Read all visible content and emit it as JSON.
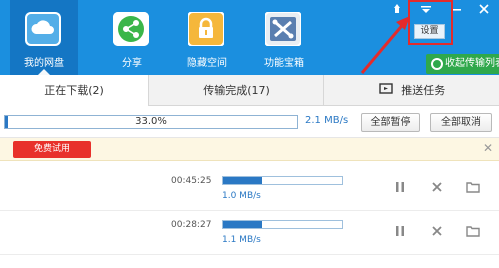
{
  "header": {
    "nav": [
      {
        "label": "我的网盘",
        "icon": "cloud-drive-icon",
        "active": true
      },
      {
        "label": "分享",
        "icon": "share-icon",
        "active": false
      },
      {
        "label": "隐藏空间",
        "icon": "lock-icon",
        "active": false
      },
      {
        "label": "功能宝箱",
        "icon": "toolbox-icon",
        "active": false
      }
    ],
    "settings_label": "设置",
    "collapse_label": "收起传输列表",
    "colors": {
      "header_bg": "#1b8fdf",
      "active_nav_bg": "#1476c4",
      "callout": "#e32b2b",
      "collapse_bg": "#2fa84b"
    }
  },
  "tabs": {
    "downloading": "正在下载(2)",
    "completed": "传输完成(17)",
    "push": "推送任务"
  },
  "overall": {
    "progress_text": "33.0%",
    "progress_value": 0.33,
    "speed": "2.1 MB/s",
    "pause_all": "全部暂停",
    "cancel_all": "全部取消"
  },
  "notice": {
    "trial_button": "免费试用",
    "close": "✕"
  },
  "tasks": [
    {
      "time": "00:45:25",
      "speed": "1.0 MB/s",
      "progress": 0.33
    },
    {
      "time": "00:28:27",
      "speed": "1.1 MB/s",
      "progress": 0.33
    }
  ]
}
